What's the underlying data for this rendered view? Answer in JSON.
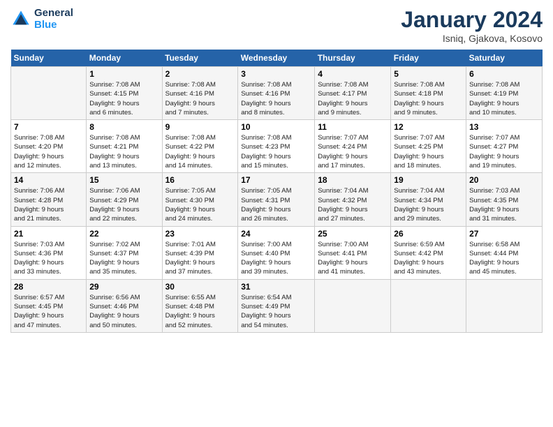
{
  "header": {
    "logo_line1": "General",
    "logo_line2": "Blue",
    "main_title": "January 2024",
    "subtitle": "Isniq, Gjakova, Kosovo"
  },
  "days_of_week": [
    "Sunday",
    "Monday",
    "Tuesday",
    "Wednesday",
    "Thursday",
    "Friday",
    "Saturday"
  ],
  "weeks": [
    [
      {
        "day": "",
        "info": ""
      },
      {
        "day": "1",
        "info": "Sunrise: 7:08 AM\nSunset: 4:15 PM\nDaylight: 9 hours\nand 6 minutes."
      },
      {
        "day": "2",
        "info": "Sunrise: 7:08 AM\nSunset: 4:16 PM\nDaylight: 9 hours\nand 7 minutes."
      },
      {
        "day": "3",
        "info": "Sunrise: 7:08 AM\nSunset: 4:16 PM\nDaylight: 9 hours\nand 8 minutes."
      },
      {
        "day": "4",
        "info": "Sunrise: 7:08 AM\nSunset: 4:17 PM\nDaylight: 9 hours\nand 9 minutes."
      },
      {
        "day": "5",
        "info": "Sunrise: 7:08 AM\nSunset: 4:18 PM\nDaylight: 9 hours\nand 9 minutes."
      },
      {
        "day": "6",
        "info": "Sunrise: 7:08 AM\nSunset: 4:19 PM\nDaylight: 9 hours\nand 10 minutes."
      }
    ],
    [
      {
        "day": "7",
        "info": "Sunrise: 7:08 AM\nSunset: 4:20 PM\nDaylight: 9 hours\nand 12 minutes."
      },
      {
        "day": "8",
        "info": "Sunrise: 7:08 AM\nSunset: 4:21 PM\nDaylight: 9 hours\nand 13 minutes."
      },
      {
        "day": "9",
        "info": "Sunrise: 7:08 AM\nSunset: 4:22 PM\nDaylight: 9 hours\nand 14 minutes."
      },
      {
        "day": "10",
        "info": "Sunrise: 7:08 AM\nSunset: 4:23 PM\nDaylight: 9 hours\nand 15 minutes."
      },
      {
        "day": "11",
        "info": "Sunrise: 7:07 AM\nSunset: 4:24 PM\nDaylight: 9 hours\nand 17 minutes."
      },
      {
        "day": "12",
        "info": "Sunrise: 7:07 AM\nSunset: 4:25 PM\nDaylight: 9 hours\nand 18 minutes."
      },
      {
        "day": "13",
        "info": "Sunrise: 7:07 AM\nSunset: 4:27 PM\nDaylight: 9 hours\nand 19 minutes."
      }
    ],
    [
      {
        "day": "14",
        "info": "Sunrise: 7:06 AM\nSunset: 4:28 PM\nDaylight: 9 hours\nand 21 minutes."
      },
      {
        "day": "15",
        "info": "Sunrise: 7:06 AM\nSunset: 4:29 PM\nDaylight: 9 hours\nand 22 minutes."
      },
      {
        "day": "16",
        "info": "Sunrise: 7:05 AM\nSunset: 4:30 PM\nDaylight: 9 hours\nand 24 minutes."
      },
      {
        "day": "17",
        "info": "Sunrise: 7:05 AM\nSunset: 4:31 PM\nDaylight: 9 hours\nand 26 minutes."
      },
      {
        "day": "18",
        "info": "Sunrise: 7:04 AM\nSunset: 4:32 PM\nDaylight: 9 hours\nand 27 minutes."
      },
      {
        "day": "19",
        "info": "Sunrise: 7:04 AM\nSunset: 4:34 PM\nDaylight: 9 hours\nand 29 minutes."
      },
      {
        "day": "20",
        "info": "Sunrise: 7:03 AM\nSunset: 4:35 PM\nDaylight: 9 hours\nand 31 minutes."
      }
    ],
    [
      {
        "day": "21",
        "info": "Sunrise: 7:03 AM\nSunset: 4:36 PM\nDaylight: 9 hours\nand 33 minutes."
      },
      {
        "day": "22",
        "info": "Sunrise: 7:02 AM\nSunset: 4:37 PM\nDaylight: 9 hours\nand 35 minutes."
      },
      {
        "day": "23",
        "info": "Sunrise: 7:01 AM\nSunset: 4:39 PM\nDaylight: 9 hours\nand 37 minutes."
      },
      {
        "day": "24",
        "info": "Sunrise: 7:00 AM\nSunset: 4:40 PM\nDaylight: 9 hours\nand 39 minutes."
      },
      {
        "day": "25",
        "info": "Sunrise: 7:00 AM\nSunset: 4:41 PM\nDaylight: 9 hours\nand 41 minutes."
      },
      {
        "day": "26",
        "info": "Sunrise: 6:59 AM\nSunset: 4:42 PM\nDaylight: 9 hours\nand 43 minutes."
      },
      {
        "day": "27",
        "info": "Sunrise: 6:58 AM\nSunset: 4:44 PM\nDaylight: 9 hours\nand 45 minutes."
      }
    ],
    [
      {
        "day": "28",
        "info": "Sunrise: 6:57 AM\nSunset: 4:45 PM\nDaylight: 9 hours\nand 47 minutes."
      },
      {
        "day": "29",
        "info": "Sunrise: 6:56 AM\nSunset: 4:46 PM\nDaylight: 9 hours\nand 50 minutes."
      },
      {
        "day": "30",
        "info": "Sunrise: 6:55 AM\nSunset: 4:48 PM\nDaylight: 9 hours\nand 52 minutes."
      },
      {
        "day": "31",
        "info": "Sunrise: 6:54 AM\nSunset: 4:49 PM\nDaylight: 9 hours\nand 54 minutes."
      },
      {
        "day": "",
        "info": ""
      },
      {
        "day": "",
        "info": ""
      },
      {
        "day": "",
        "info": ""
      }
    ]
  ]
}
